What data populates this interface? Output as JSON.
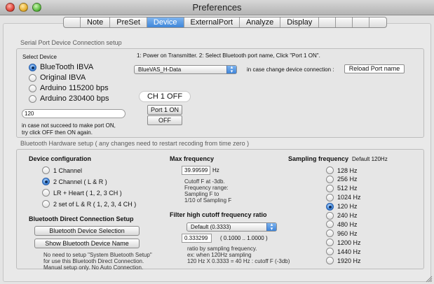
{
  "window": {
    "title": "Preferences"
  },
  "tabs": [
    "Note",
    "PreSet",
    "Device",
    "ExternalPort",
    "Analyze",
    "Display"
  ],
  "active_tab": "Device",
  "serial": {
    "section_title": "Serial Port Device Connection setup",
    "select_device_label": "Select Device",
    "devices": [
      {
        "label": "BlueTooth IBVA",
        "selected": true
      },
      {
        "label": "Original IBVA",
        "selected": false
      },
      {
        "label": "Arduino 115200 bps",
        "selected": false
      },
      {
        "label": "Arduino 230400 bps",
        "selected": false
      }
    ],
    "port_value": "120",
    "hint": "in case not succeed to make port ON,\ntry click OFF then ON again.",
    "instruction": "1: Power on Transmitter.  2: Select Bluetooth port name, Click \"Port 1 ON\".",
    "port_select_value": "BlueVAS_H-Data",
    "change_label": "in case change device connection :",
    "reload_label": "Reload Port name",
    "channel_status": "CH 1 OFF",
    "port_on_label": "Port 1 ON",
    "off_label": "OFF"
  },
  "bt": {
    "section_title": "Bluetooth Hardware setup ( any changes need to restart recoding from time zero )",
    "config_label": "Device configuration",
    "configs": [
      {
        "label": "1 Channel",
        "selected": false
      },
      {
        "label": "2 Channel ( L & R )",
        "selected": true
      },
      {
        "label": "LR + Heart ( 1, 2, 3 CH )",
        "selected": false
      },
      {
        "label": "2 set of L & R ( 1, 2, 3, 4 CH )",
        "selected": false
      }
    ],
    "direct_title": "Bluetooth Direct Connection Setup",
    "selection_button": "Bluetooth Device Selection",
    "show_name_button": "Show Bluetooth Device Name",
    "direct_note": "No need to setup \"System Bluetooth Setup\"\nfor use this Bluetooth Direct Connection.\nManual setup only. No Auto Connection.",
    "max_freq_label": "Max frequency",
    "max_freq_value": "39.99599",
    "hz_unit": "Hz",
    "cutoff_note": "Cutoff F at -3db.\nFrequency range:\nSampling F to\n1/10 of Sampling F",
    "filter_label": "Filter high cutoff frequency ratio",
    "filter_select_value": "Default (0.3333)",
    "ratio_value": "0.333299",
    "ratio_range": "( 0.1000 .. 1.0000 )",
    "ratio_note": "ratio by sampling frequency.\nex: when 120Hz sampling\n120 Hz X 0.3333 = 40 Hz : cutoff F (-3db)",
    "sampling_label": "Sampling frequency",
    "sampling_default": "Default 120Hz",
    "sampling_options": [
      {
        "label": "128 Hz",
        "selected": false
      },
      {
        "label": "256 Hz",
        "selected": false
      },
      {
        "label": "512 Hz",
        "selected": false
      },
      {
        "label": "1024 Hz",
        "selected": false
      },
      {
        "label": "120 Hz",
        "selected": true
      },
      {
        "label": "240 Hz",
        "selected": false
      },
      {
        "label": "480 Hz",
        "selected": false
      },
      {
        "label": "960 Hz",
        "selected": false
      },
      {
        "label": "1200 Hz",
        "selected": false
      },
      {
        "label": "1440 Hz",
        "selected": false
      },
      {
        "label": "1920 Hz",
        "selected": false
      }
    ]
  }
}
